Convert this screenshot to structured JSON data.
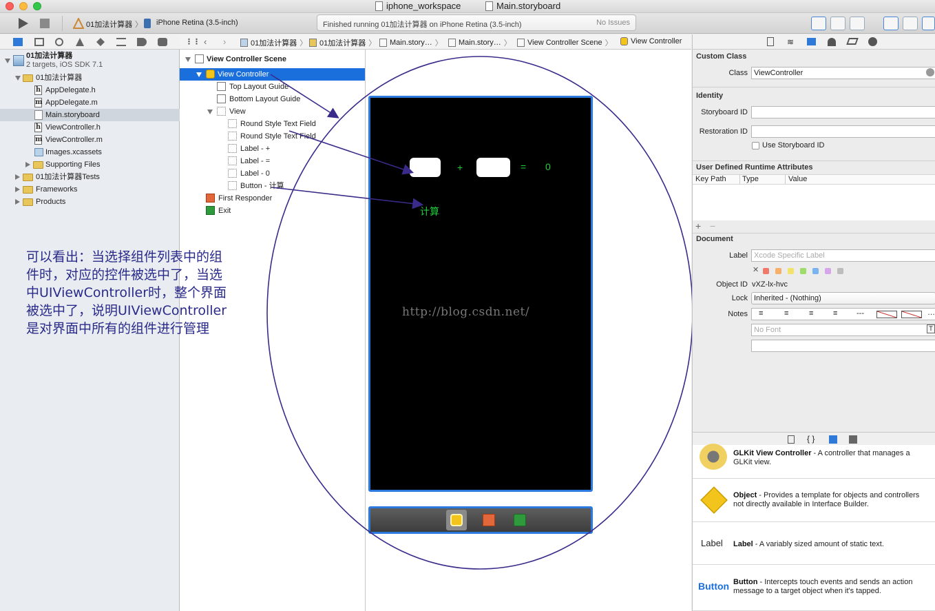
{
  "window": {
    "tabs": [
      "iphone_workspace",
      "Main.storyboard"
    ]
  },
  "toolbar": {
    "scheme": "01加法计算器",
    "device": "iPhone Retina (3.5-inch)",
    "status": "Finished running 01加法计算器 on iPhone Retina (3.5-inch)",
    "issues": "No Issues"
  },
  "navigator": {
    "project_name": "01加法计算器",
    "project_sub": "2 targets, iOS SDK 7.1",
    "group": "01加法计算器",
    "files": [
      "AppDelegate.h",
      "AppDelegate.m",
      "Main.storyboard",
      "ViewController.h",
      "ViewController.m",
      "Images.xcassets",
      "Supporting Files"
    ],
    "groups": [
      "01加法计算器Tests",
      "Frameworks",
      "Products"
    ]
  },
  "annotation": "可以看出：当选择组件列表中的组件时，对应的控件被选中了，当选中UIViewController时，整个界面被选中了，说明UIViewController是对界面中所有的组件进行管理",
  "jumpbar": [
    "01加法计算器",
    "01加法计算器",
    "Main.story…",
    "Main.story…",
    "View Controller Scene",
    "View Controller"
  ],
  "outline": {
    "scene": "View Controller Scene",
    "controller": "View Controller",
    "items": [
      "Top Layout Guide",
      "Bottom Layout Guide",
      "View"
    ],
    "subviews": [
      "Round Style Text Field",
      "Round Style Text Field",
      "Label - +",
      "Label - =",
      "Label - 0",
      "Button - 计算"
    ],
    "first_responder": "First Responder",
    "exit": "Exit"
  },
  "canvas": {
    "plus": "+",
    "equals": "=",
    "result": "0",
    "button": "计算",
    "watermark": "http://blog.csdn.net/"
  },
  "inspector": {
    "custom_class_title": "Custom Class",
    "class_label": "Class",
    "class_value": "ViewController",
    "identity_title": "Identity",
    "storyboard_id_label": "Storyboard ID",
    "restoration_id_label": "Restoration ID",
    "use_storyboard_id": "Use Storyboard ID",
    "runtime_title": "User Defined Runtime Attributes",
    "runtime_cols": [
      "Key Path",
      "Type",
      "Value"
    ],
    "document_title": "Document",
    "doc_label_label": "Label",
    "doc_label_placeholder": "Xcode Specific Label",
    "object_id_label": "Object ID",
    "object_id_value": "vXZ-lx-hvc",
    "lock_label": "Lock",
    "lock_value": "Inherited - (Nothing)",
    "notes_label": "Notes",
    "font_placeholder": "No Font"
  },
  "library": [
    {
      "icon": "glkit-icon",
      "title": "GLKit View Controller",
      "desc": " - A controller that manages a GLKit view."
    },
    {
      "icon": "object-cube-icon",
      "title": "Object",
      "desc": " - Provides a template for objects and controllers not directly available in Interface Builder."
    },
    {
      "icon": "label-icon",
      "icon_text": "Label",
      "title": "Label",
      "desc": " - A variably sized amount of static text."
    },
    {
      "icon": "button-icon",
      "icon_text": "Button",
      "title": "Button",
      "desc": " - Intercepts touch events and sends an action message to a target object when it's tapped."
    }
  ],
  "colors": {
    "selection": "#1b6fdc",
    "annotation_ink": "#2a2a8a",
    "canvas_label": "#1fd13c",
    "frame": "#2c7ae0"
  }
}
